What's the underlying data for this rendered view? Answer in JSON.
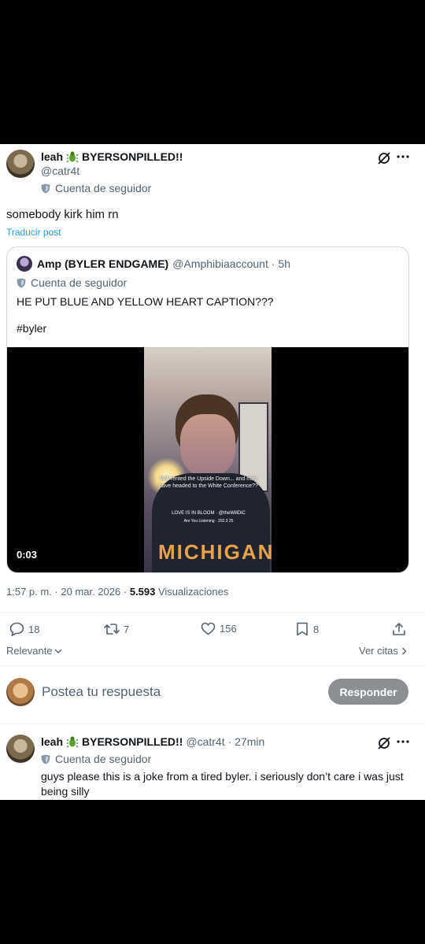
{
  "tweet": {
    "author_name": "leah",
    "author_suffix": "BYERSONPILLED!!",
    "handle": "@catr4t",
    "follower_label": "Cuenta de seguidor",
    "text": "somebody kirk him rn",
    "translate": "Traducir post",
    "timestamp": "1:57 p. m. · 20 mar. 2026 · ",
    "views_count": "5.593",
    "views_label": " Visualizaciones"
  },
  "quote": {
    "author_name": "Amp (BYLER ENDGAME)",
    "handle": "@Amphibiaaccount",
    "time": "· 5h",
    "follower_label": "Cuenta de seguidor",
    "line1": "HE PUT BLUE AND YELLOW HEART CAPTION???",
    "line2": "#byler",
    "video_duration": "0:03",
    "video_caption": "Will rented the Upside Down... and may have headed to the White Conference??",
    "video_tag": "LOVE IS IN BLOOM · @theWillDiC",
    "video_sub": "Are You Listening · 202.3 25"
  },
  "actions": {
    "replies": "18",
    "retweets": "7",
    "likes": "156",
    "bookmarks": "8"
  },
  "sort": {
    "relevance": "Relevante",
    "quotes": "Ver citas"
  },
  "compose": {
    "placeholder": "Postea tu respuesta",
    "reply_button": "Responder"
  },
  "reply": {
    "author_name": "leah",
    "author_suffix": "BYERSONPILLED!!",
    "handle": "@catr4t",
    "time": "· 27min",
    "follower_label": "Cuenta de seguidor",
    "text": "guys please this is a joke from a tired byler. i seriously don’t care i was just being silly"
  },
  "colors": {
    "accent": "#1d9bf0",
    "muted": "#536471",
    "button_bg": "#8b8f93"
  }
}
